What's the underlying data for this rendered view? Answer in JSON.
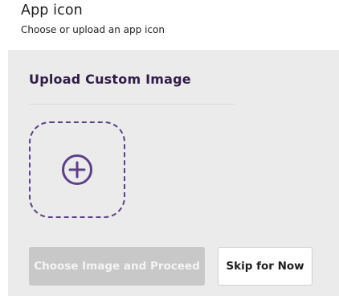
{
  "header": {
    "title": "App icon",
    "subtitle": "Choose or upload an app icon"
  },
  "upload": {
    "section_title": "Upload Custom Image",
    "dropzone_icon": "plus-circle-icon"
  },
  "actions": {
    "proceed_label": "Choose Image and Proceed",
    "proceed_disabled": true,
    "skip_label": "Skip for Now"
  },
  "colors": {
    "accent": "#5e3f86",
    "heading": "#2f1c47",
    "panel_bg": "#ebebeb",
    "disabled_button": "#c8c8c8"
  }
}
